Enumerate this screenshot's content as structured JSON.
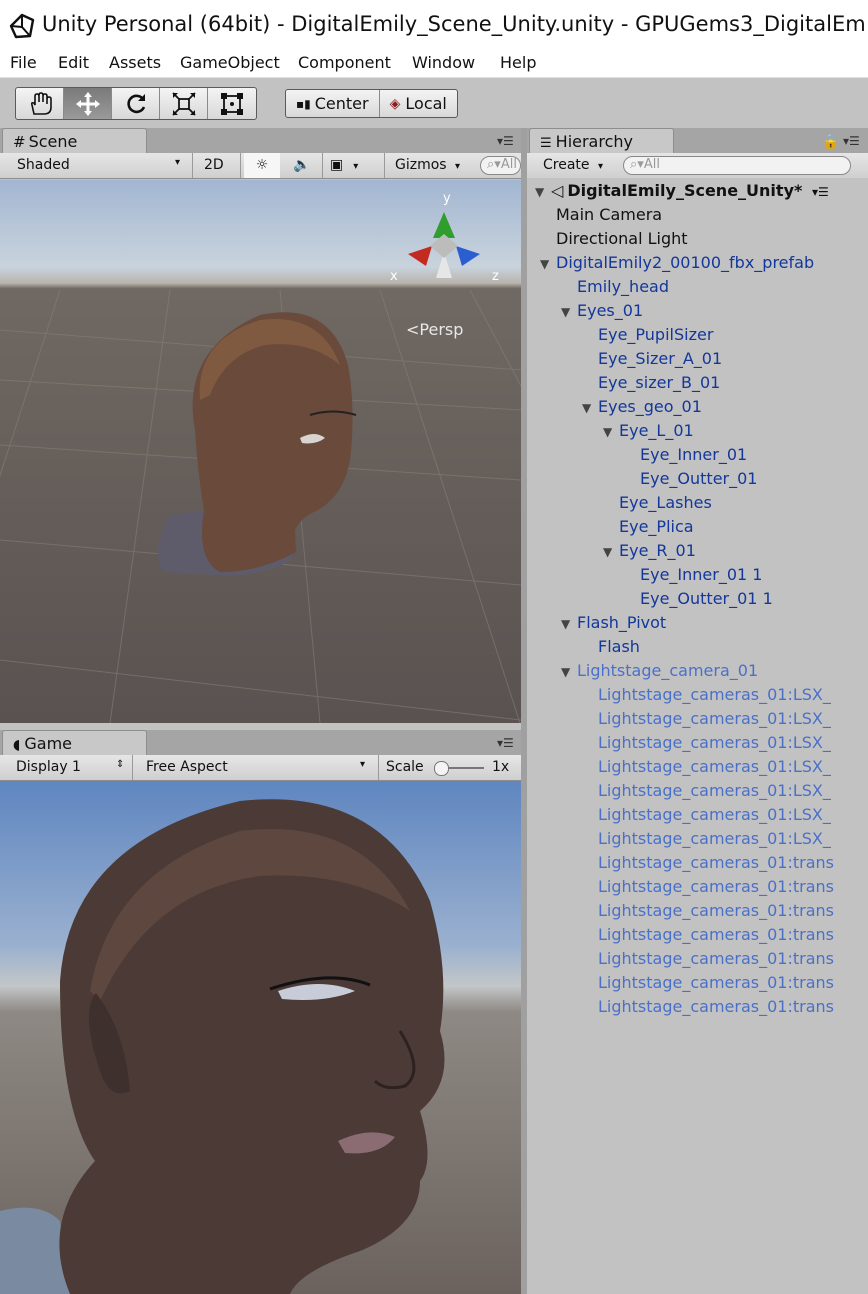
{
  "window": {
    "title": "Unity Personal (64bit) - DigitalEmily_Scene_Unity.unity - GPUGems3_DigitalEm"
  },
  "menu": [
    "File",
    "Edit",
    "Assets",
    "GameObject",
    "Component",
    "Window",
    "Help"
  ],
  "toolbar": {
    "tools": [
      {
        "icon": "hand-icon"
      },
      {
        "icon": "move-icon"
      },
      {
        "icon": "rotate-icon"
      },
      {
        "icon": "scale-icon"
      },
      {
        "icon": "rect-icon"
      }
    ],
    "pivot": "Center",
    "space": "Local"
  },
  "scene": {
    "tab": "Scene",
    "shading": "Shaded",
    "mode_2d": "2D",
    "gizmos": "Gizmos",
    "search_placeholder": "All",
    "persp": "Persp",
    "axis_y": "y",
    "axis_x": "x",
    "axis_z": "z"
  },
  "game": {
    "tab": "Game",
    "display": "Display 1",
    "aspect": "Free Aspect",
    "scale_label": "Scale",
    "scale_value": "1x"
  },
  "hierarchy": {
    "tab": "Hierarchy",
    "create": "Create",
    "search_placeholder": "All",
    "scene_name": "DigitalEmily_Scene_Unity*",
    "rows": [
      {
        "label": "Main Camera",
        "depth": 1,
        "expander": false,
        "style": "black"
      },
      {
        "label": "Directional Light",
        "depth": 1,
        "expander": false,
        "style": "black"
      },
      {
        "label": "DigitalEmily2_00100_fbx_prefab",
        "depth": 1,
        "expander": true,
        "style": "blue"
      },
      {
        "label": "Emily_head",
        "depth": 2,
        "expander": false,
        "style": "blue"
      },
      {
        "label": "Eyes_01",
        "depth": 2,
        "expander": true,
        "style": "blue"
      },
      {
        "label": "Eye_PupilSizer",
        "depth": 3,
        "expander": false,
        "style": "blue"
      },
      {
        "label": "Eye_Sizer_A_01",
        "depth": 3,
        "expander": false,
        "style": "blue"
      },
      {
        "label": "Eye_sizer_B_01",
        "depth": 3,
        "expander": false,
        "style": "blue"
      },
      {
        "label": "Eyes_geo_01",
        "depth": 3,
        "expander": true,
        "style": "blue"
      },
      {
        "label": "Eye_L_01",
        "depth": 4,
        "expander": true,
        "style": "blue"
      },
      {
        "label": "Eye_Inner_01",
        "depth": 5,
        "expander": false,
        "style": "blue"
      },
      {
        "label": "Eye_Outter_01",
        "depth": 5,
        "expander": false,
        "style": "blue"
      },
      {
        "label": "Eye_Lashes",
        "depth": 4,
        "expander": false,
        "style": "blue"
      },
      {
        "label": "Eye_Plica",
        "depth": 4,
        "expander": false,
        "style": "blue"
      },
      {
        "label": "Eye_R_01",
        "depth": 4,
        "expander": true,
        "style": "blue"
      },
      {
        "label": "Eye_Inner_01 1",
        "depth": 5,
        "expander": false,
        "style": "blue"
      },
      {
        "label": "Eye_Outter_01 1",
        "depth": 5,
        "expander": false,
        "style": "blue"
      },
      {
        "label": "Flash_Pivot",
        "depth": 2,
        "expander": true,
        "style": "blue"
      },
      {
        "label": "Flash",
        "depth": 3,
        "expander": false,
        "style": "blue"
      },
      {
        "label": "Lightstage_camera_01",
        "depth": 2,
        "expander": true,
        "style": "faded"
      },
      {
        "label": "Lightstage_cameras_01:LSX_",
        "depth": 3,
        "expander": false,
        "style": "faded"
      },
      {
        "label": "Lightstage_cameras_01:LSX_",
        "depth": 3,
        "expander": false,
        "style": "faded"
      },
      {
        "label": "Lightstage_cameras_01:LSX_",
        "depth": 3,
        "expander": false,
        "style": "faded"
      },
      {
        "label": "Lightstage_cameras_01:LSX_",
        "depth": 3,
        "expander": false,
        "style": "faded"
      },
      {
        "label": "Lightstage_cameras_01:LSX_",
        "depth": 3,
        "expander": false,
        "style": "faded"
      },
      {
        "label": "Lightstage_cameras_01:LSX_",
        "depth": 3,
        "expander": false,
        "style": "faded"
      },
      {
        "label": "Lightstage_cameras_01:LSX_",
        "depth": 3,
        "expander": false,
        "style": "faded"
      },
      {
        "label": "Lightstage_cameras_01:trans",
        "depth": 3,
        "expander": false,
        "style": "faded"
      },
      {
        "label": "Lightstage_cameras_01:trans",
        "depth": 3,
        "expander": false,
        "style": "faded"
      },
      {
        "label": "Lightstage_cameras_01:trans",
        "depth": 3,
        "expander": false,
        "style": "faded"
      },
      {
        "label": "Lightstage_cameras_01:trans",
        "depth": 3,
        "expander": false,
        "style": "faded"
      },
      {
        "label": "Lightstage_cameras_01:trans",
        "depth": 3,
        "expander": false,
        "style": "faded"
      },
      {
        "label": "Lightstage_cameras_01:trans",
        "depth": 3,
        "expander": false,
        "style": "faded"
      },
      {
        "label": "Lightstage_cameras_01:trans",
        "depth": 3,
        "expander": false,
        "style": "faded"
      }
    ]
  }
}
